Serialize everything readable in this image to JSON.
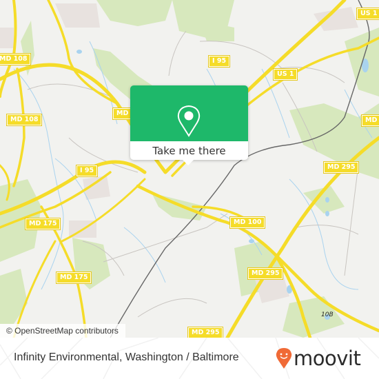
{
  "map": {
    "attribution": "© OpenStreetMap contributors",
    "road_labels": [
      {
        "id": "md108-a",
        "text": "MD 108"
      },
      {
        "id": "md108-b",
        "text": "MD 108"
      },
      {
        "id": "md-a",
        "text": "MD"
      },
      {
        "id": "i95-a",
        "text": "I 95"
      },
      {
        "id": "i95-b",
        "text": "I 95"
      },
      {
        "id": "us1-a",
        "text": "US 1"
      },
      {
        "id": "us1-b",
        "text": "US 1"
      },
      {
        "id": "md-b",
        "text": "MD"
      },
      {
        "id": "md295-a",
        "text": "MD 295"
      },
      {
        "id": "md175-a",
        "text": "MD 175"
      },
      {
        "id": "md175-b",
        "text": "MD 175"
      },
      {
        "id": "md100",
        "text": "MD 100"
      },
      {
        "id": "md295-b",
        "text": "MD 295"
      },
      {
        "id": "md295-c",
        "text": "MD 295"
      }
    ],
    "exit_label": "10B",
    "colors": {
      "background": "#f2f2ef",
      "road": "#f5dc29",
      "park": "#cfe5b0",
      "water": "#a9d3ef",
      "rail": "#666666"
    }
  },
  "popup": {
    "button_label": "Take me there",
    "icon": "map-pin-icon",
    "color": "#1eb86a"
  },
  "footer": {
    "title": "Infinity Environmental, Washington / Baltimore",
    "brand": "moovit",
    "brand_color": "#f06a36"
  }
}
